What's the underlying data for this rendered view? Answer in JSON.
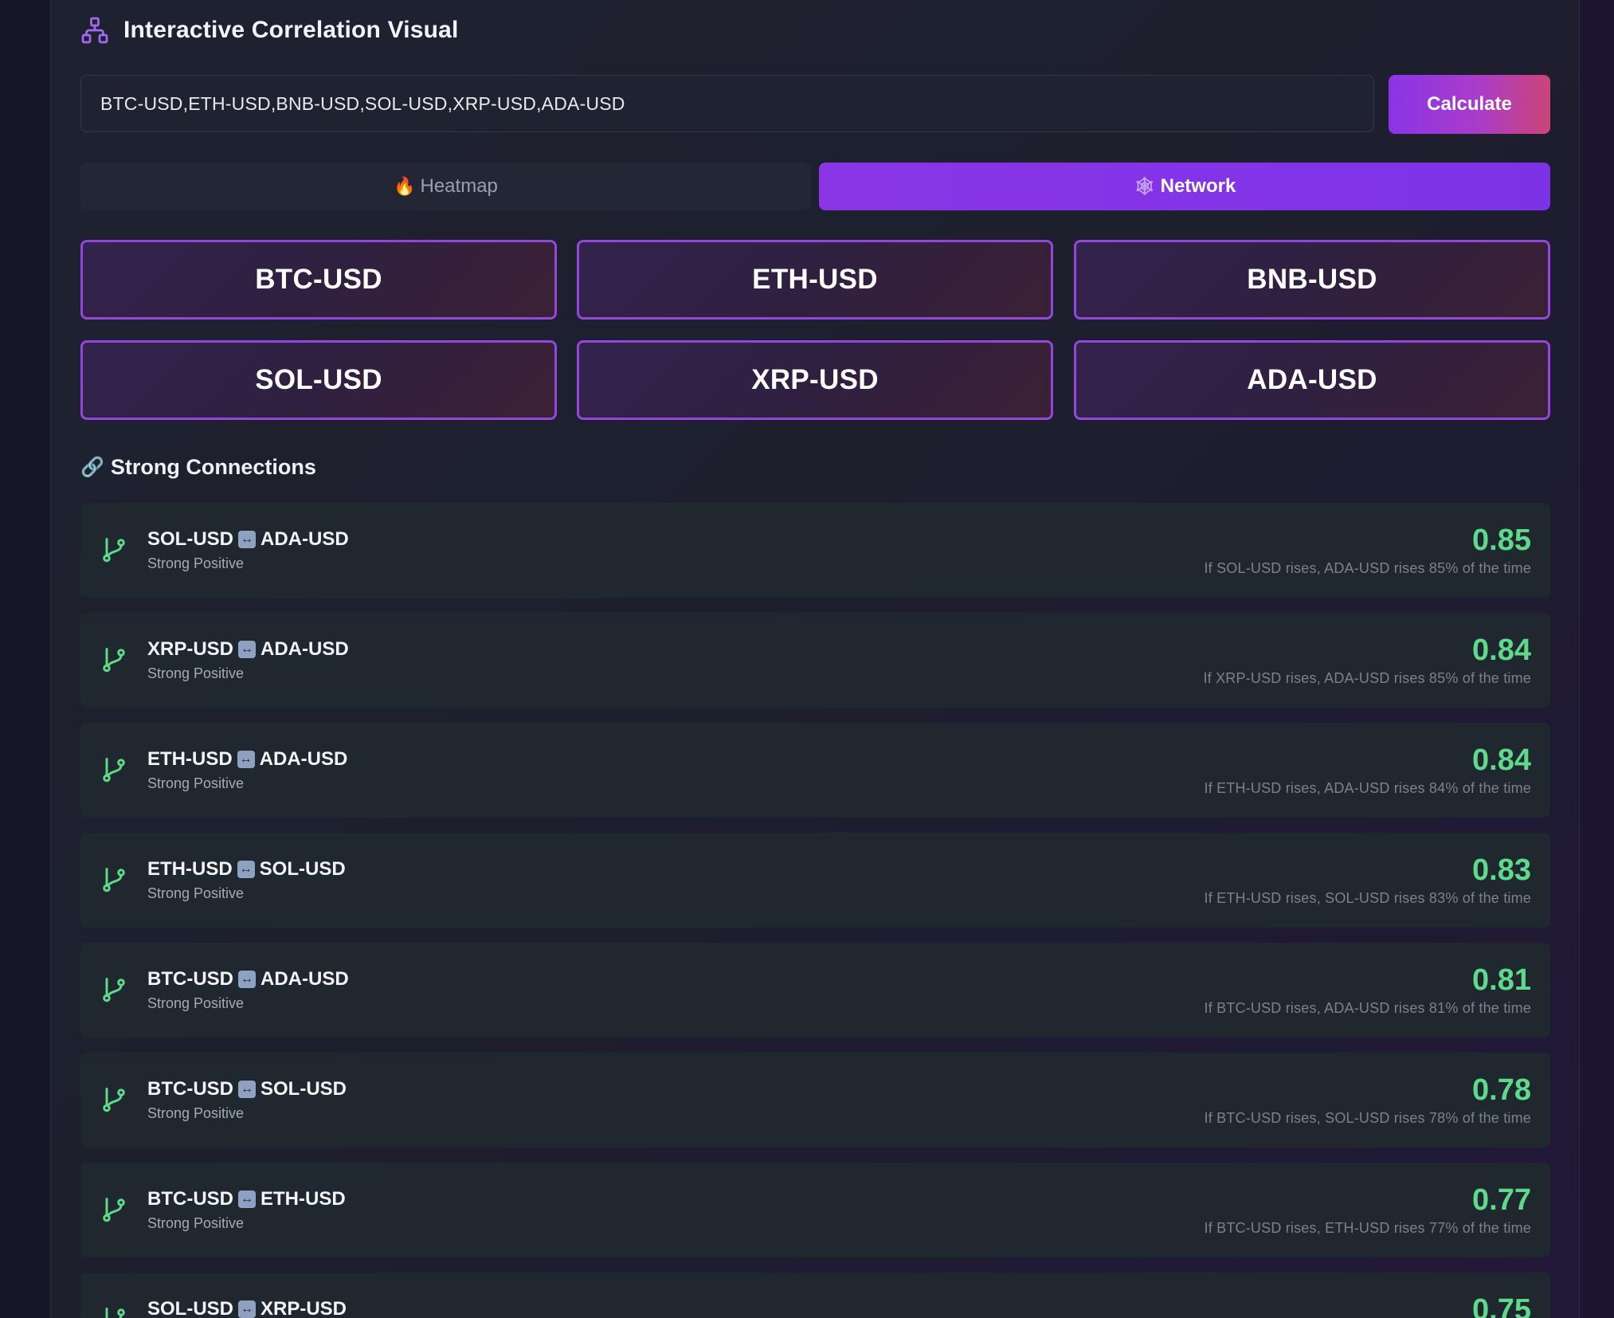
{
  "header": {
    "title": "Interactive Correlation Visual",
    "icon": "network-icon"
  },
  "tickers_input": {
    "value": "BTC-USD,ETH-USD,BNB-USD,SOL-USD,XRP-USD,ADA-USD"
  },
  "calculate_label": "Calculate",
  "tabs": [
    {
      "label": "Heatmap",
      "icon": "🔥",
      "active": false
    },
    {
      "label": "Network",
      "icon": "🕸",
      "active": true
    }
  ],
  "nodes": [
    "BTC-USD",
    "ETH-USD",
    "BNB-USD",
    "SOL-USD",
    "XRP-USD",
    "ADA-USD"
  ],
  "connections_title": "Strong Connections",
  "connections_icon": "🔗",
  "pair_separator": "↔",
  "connections": [
    {
      "a": "SOL-USD",
      "b": "ADA-USD",
      "strength": "Strong Positive",
      "value": "0.85",
      "desc": "If SOL-USD rises, ADA-USD rises 85% of the time"
    },
    {
      "a": "XRP-USD",
      "b": "ADA-USD",
      "strength": "Strong Positive",
      "value": "0.84",
      "desc": "If XRP-USD rises, ADA-USD rises 85% of the time"
    },
    {
      "a": "ETH-USD",
      "b": "ADA-USD",
      "strength": "Strong Positive",
      "value": "0.84",
      "desc": "If ETH-USD rises, ADA-USD rises 84% of the time"
    },
    {
      "a": "ETH-USD",
      "b": "SOL-USD",
      "strength": "Strong Positive",
      "value": "0.83",
      "desc": "If ETH-USD rises, SOL-USD rises 83% of the time"
    },
    {
      "a": "BTC-USD",
      "b": "ADA-USD",
      "strength": "Strong Positive",
      "value": "0.81",
      "desc": "If BTC-USD rises, ADA-USD rises 81% of the time"
    },
    {
      "a": "BTC-USD",
      "b": "SOL-USD",
      "strength": "Strong Positive",
      "value": "0.78",
      "desc": "If BTC-USD rises, SOL-USD rises 78% of the time"
    },
    {
      "a": "BTC-USD",
      "b": "ETH-USD",
      "strength": "Strong Positive",
      "value": "0.77",
      "desc": "If BTC-USD rises, ETH-USD rises 77% of the time"
    },
    {
      "a": "SOL-USD",
      "b": "XRP-USD",
      "strength": "",
      "value": "0.75",
      "desc": ""
    }
  ],
  "colors": {
    "accent_purple": "#8a35e6",
    "positive_green": "#5fd98a",
    "node_border": "#9446dc"
  }
}
